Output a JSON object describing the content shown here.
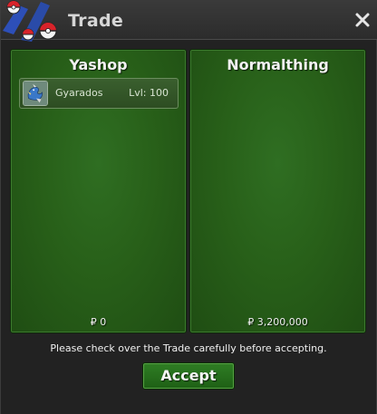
{
  "window": {
    "title": "Trade",
    "close_icon": "close-icon",
    "logo_icon": "pokeball-logo-icon"
  },
  "trade": {
    "left": {
      "player": "Yashop",
      "money": "₽ 0",
      "items": [
        {
          "name": "Gyarados",
          "level": "Lvl: 100",
          "icon": "gyarados-sprite-icon"
        }
      ]
    },
    "right": {
      "player": "Normalthing",
      "money": "₽ 3,200,000",
      "items": []
    }
  },
  "footer": {
    "notice": "Please check over the Trade carefully before accepting.",
    "accept_label": "Accept"
  },
  "colors": {
    "panel_green": "#286019",
    "button_green": "#2f7e24",
    "window_bg": "#222222"
  }
}
